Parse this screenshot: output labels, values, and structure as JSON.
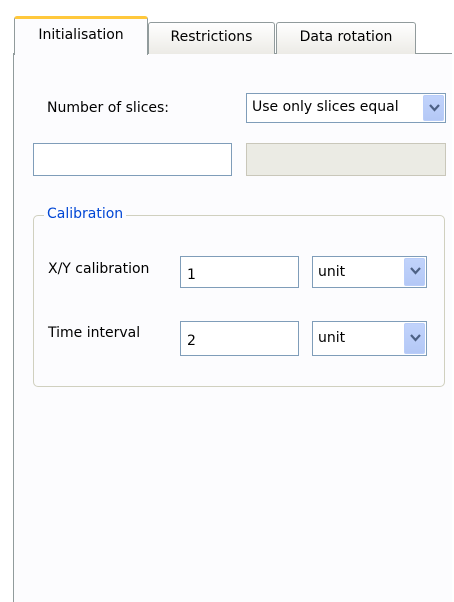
{
  "tabs": [
    {
      "label": "Initialisation",
      "active": true
    },
    {
      "label": "Restrictions",
      "active": false
    },
    {
      "label": "Data rotation",
      "active": false
    }
  ],
  "slices": {
    "label": "Number of slices:",
    "mode_selected": "Use only slices equal",
    "value_input": "",
    "value_input_disabled": ""
  },
  "calibration": {
    "title": "Calibration",
    "xy": {
      "label": "X/Y calibration",
      "value": "1",
      "unit": "unit"
    },
    "time": {
      "label": "Time interval",
      "value": "2",
      "unit": "unit"
    }
  },
  "colors": {
    "accent_tab": "#ffc83c",
    "group_title": "#0046d5",
    "input_border": "#7f9db9",
    "dropdown_button": "#c1d3fb"
  },
  "icons": {
    "dropdown": "chevron-down-icon"
  }
}
